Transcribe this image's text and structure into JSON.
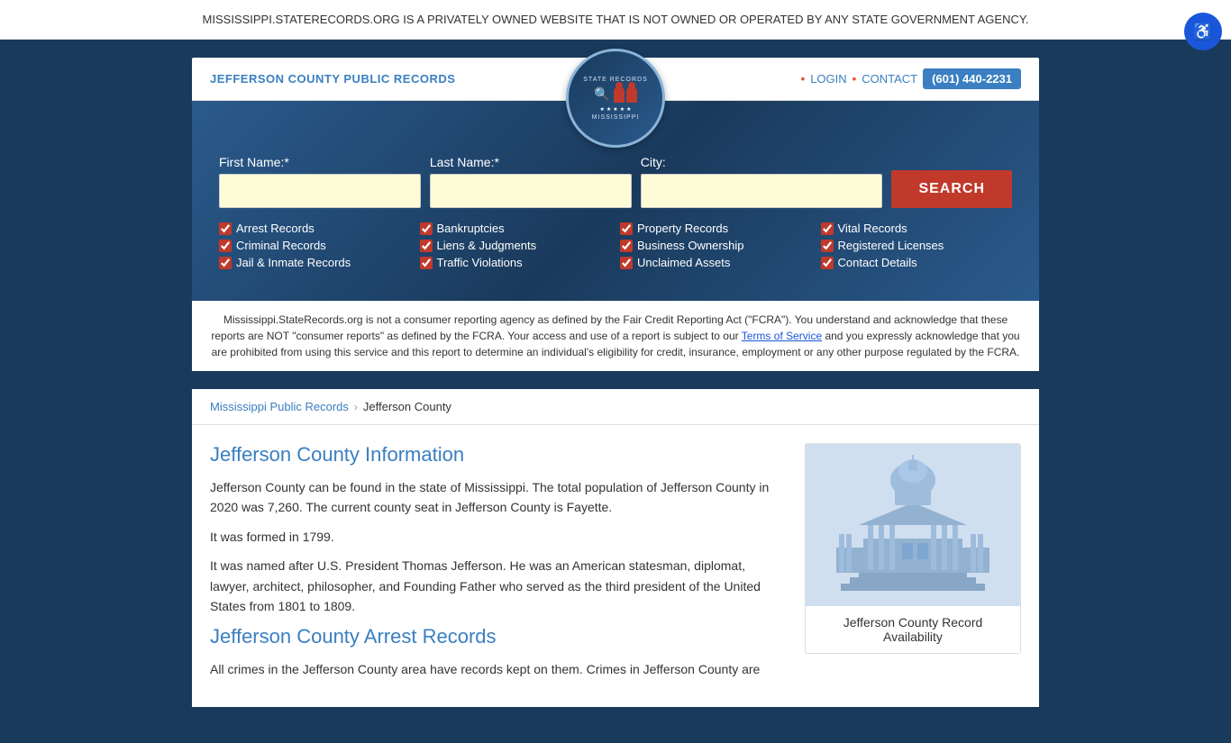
{
  "banner": {
    "text": "MISSISSIPPI.STATERECORDS.ORG IS A PRIVATELY OWNED WEBSITE THAT IS NOT OWNED OR OPERATED BY ANY STATE GOVERNMENT AGENCY.",
    "close_label": "×"
  },
  "header": {
    "title": "JEFFERSON COUNTY PUBLIC RECORDS",
    "login_label": "LOGIN",
    "contact_label": "CONTACT",
    "phone": "(601) 440-2231",
    "dot": "•"
  },
  "logo": {
    "top_text": "STATE RECORDS",
    "bottom_text": "MISSISSIPPI",
    "stars": [
      "★",
      "★",
      "★",
      "★",
      "★"
    ]
  },
  "search_form": {
    "first_name_label": "First Name:*",
    "last_name_label": "Last Name:*",
    "city_label": "City:",
    "search_button_label": "SEARCH"
  },
  "checkboxes": [
    {
      "label": "Arrest Records",
      "checked": true
    },
    {
      "label": "Bankruptcies",
      "checked": true
    },
    {
      "label": "Property Records",
      "checked": true
    },
    {
      "label": "Vital Records",
      "checked": true
    },
    {
      "label": "Criminal Records",
      "checked": true
    },
    {
      "label": "Liens & Judgments",
      "checked": true
    },
    {
      "label": "Business Ownership",
      "checked": true
    },
    {
      "label": "Registered Licenses",
      "checked": true
    },
    {
      "label": "Jail & Inmate Records",
      "checked": true
    },
    {
      "label": "Traffic Violations",
      "checked": true
    },
    {
      "label": "Unclaimed Assets",
      "checked": true
    },
    {
      "label": "Contact Details",
      "checked": true
    }
  ],
  "disclaimer": {
    "text1": "Mississippi.StateRecords.org is not a consumer reporting agency as defined by the Fair Credit Reporting Act (\"FCRA\"). You understand and acknowledge that these reports are NOT \"consumer reports\" as defined by the FCRA. Your access and use of a report is subject to our ",
    "tos_link": "Terms of Service",
    "text2": " and you expressly acknowledge that you are prohibited from using this service and this report to determine an individual's eligibility for credit, insurance, employment or any other purpose regulated by the FCRA."
  },
  "breadcrumb": {
    "parent_label": "Mississippi Public Records",
    "current_label": "Jefferson County"
  },
  "main_content": {
    "info_title": "Jefferson County Information",
    "info_para1": "Jefferson County can be found in the state of Mississippi. The total population of Jefferson County in 2020 was 7,260. The current county seat in Jefferson County is Fayette.",
    "info_para2": "It was formed in 1799.",
    "info_para3": "It was named after U.S. President Thomas Jefferson. He was an American statesman, diplomat, lawyer, architect, philosopher, and Founding Father who served as the third president of the United States from 1801 to 1809.",
    "arrest_title": "Jefferson County Arrest Records",
    "arrest_para": "All crimes in the Jefferson County area have records kept on them. Crimes in Jefferson County are"
  },
  "sidebar": {
    "card_label": "Jefferson County Record Availability"
  },
  "accessibility": {
    "icon": "♿"
  }
}
